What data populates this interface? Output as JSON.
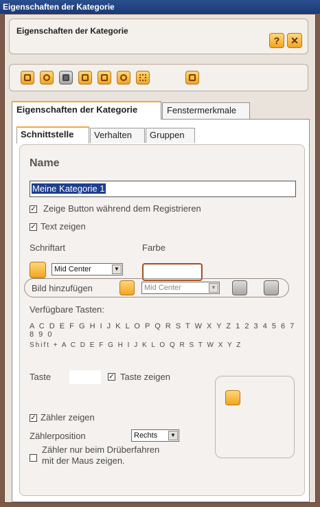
{
  "window": {
    "title": "Eigenschaften der Kategorie"
  },
  "header": {
    "title": "Eigenschaften der Kategorie",
    "help_label": "?",
    "close_label": "✕"
  },
  "toolbar": {
    "icons": [
      "brush-icon",
      "hexagon-icon",
      "stop-icon",
      "hand-icon",
      "list-icon",
      "paint-icon",
      "grid-icon",
      "window-icon"
    ]
  },
  "tabs_main": [
    "Eigenschaften der Kategorie",
    "Fenstermerkmale"
  ],
  "tabs_sub": [
    "Schnittstelle",
    "Verhalten",
    "Gruppen"
  ],
  "form": {
    "name_title": "Name",
    "name_value": "Meine Kategorie 1",
    "show_button_register": "Zeige Button während dem Registrieren",
    "show_text": "Text zeigen",
    "font_label": "Schriftart",
    "color_label": "Farbe",
    "font_align": "Mid Center",
    "add_image_label": "Bild hinzufügen",
    "image_align": "Mid Center",
    "keys_label": "Verfügbare Tasten:",
    "keys_row1": "A C D E F G H I J K L O P Q R S T W X Y Z 1 2 3 4 5 6 7 8 9 0",
    "keys_row2": "Shift + A C D E F G H I J K L O Q R S T W X Y Z",
    "key_label": "Taste",
    "show_key": "Taste zeigen",
    "show_counter": "Zähler zeigen",
    "counter_position_label": "Zählerposition",
    "counter_position": "Rechts",
    "counter_hover_line1": "Zähler nur beim Drüberfahren",
    "counter_hover_line2": "mit der Maus zeigen."
  },
  "checkbox_states": {
    "show_button_register": true,
    "show_text": true,
    "show_key": true,
    "show_counter": true,
    "counter_hover": false
  }
}
